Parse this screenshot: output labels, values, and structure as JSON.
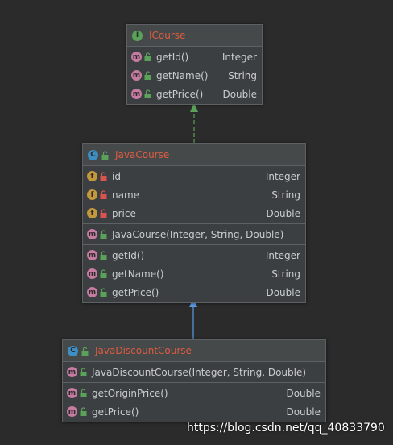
{
  "icourse": {
    "kind": "I",
    "name": "ICourse",
    "methods": [
      {
        "name": "getId()",
        "type": "Integer"
      },
      {
        "name": "getName()",
        "type": "String"
      },
      {
        "name": "getPrice()",
        "type": "Double"
      }
    ]
  },
  "javacourse": {
    "kind": "C",
    "name": "JavaCourse",
    "fields": [
      {
        "name": "id",
        "type": "Integer"
      },
      {
        "name": "name",
        "type": "String"
      },
      {
        "name": "price",
        "type": "Double"
      }
    ],
    "constructor": {
      "name": "JavaCourse(Integer, String, Double)"
    },
    "methods": [
      {
        "name": "getId()",
        "type": "Integer"
      },
      {
        "name": "getName()",
        "type": "String"
      },
      {
        "name": "getPrice()",
        "type": "Double"
      }
    ]
  },
  "javadiscountcourse": {
    "kind": "C",
    "name": "JavaDiscountCourse",
    "constructor": {
      "name": "JavaDiscountCourse(Integer, String, Double)"
    },
    "methods": [
      {
        "name": "getOriginPrice()",
        "type": "Double"
      },
      {
        "name": "getPrice()",
        "type": "Double"
      }
    ]
  },
  "badge_letters": {
    "method": "m",
    "field": "f"
  },
  "watermark": "https://blog.csdn.net/qq_40833790",
  "colors": {
    "background": "#2b2b2b",
    "title": "#dd5c40",
    "realization_arrow": "#5aa15a",
    "inheritance_arrow": "#5a9de3"
  }
}
